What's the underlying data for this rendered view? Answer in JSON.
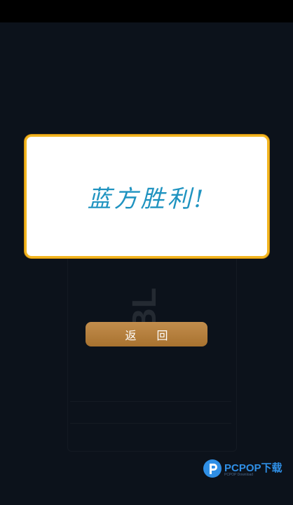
{
  "dialog": {
    "result_text": "蓝方胜利!"
  },
  "buttons": {
    "back_label": "返 回"
  },
  "background": {
    "faint_text": "BL"
  },
  "watermark": {
    "brand": "PCPOP下载",
    "sub": "PCPOP Download"
  },
  "colors": {
    "dialog_border": "#f3b620",
    "result_text": "#1f93c0",
    "button": "#b37d3b",
    "screen_bg": "#0c121b"
  }
}
